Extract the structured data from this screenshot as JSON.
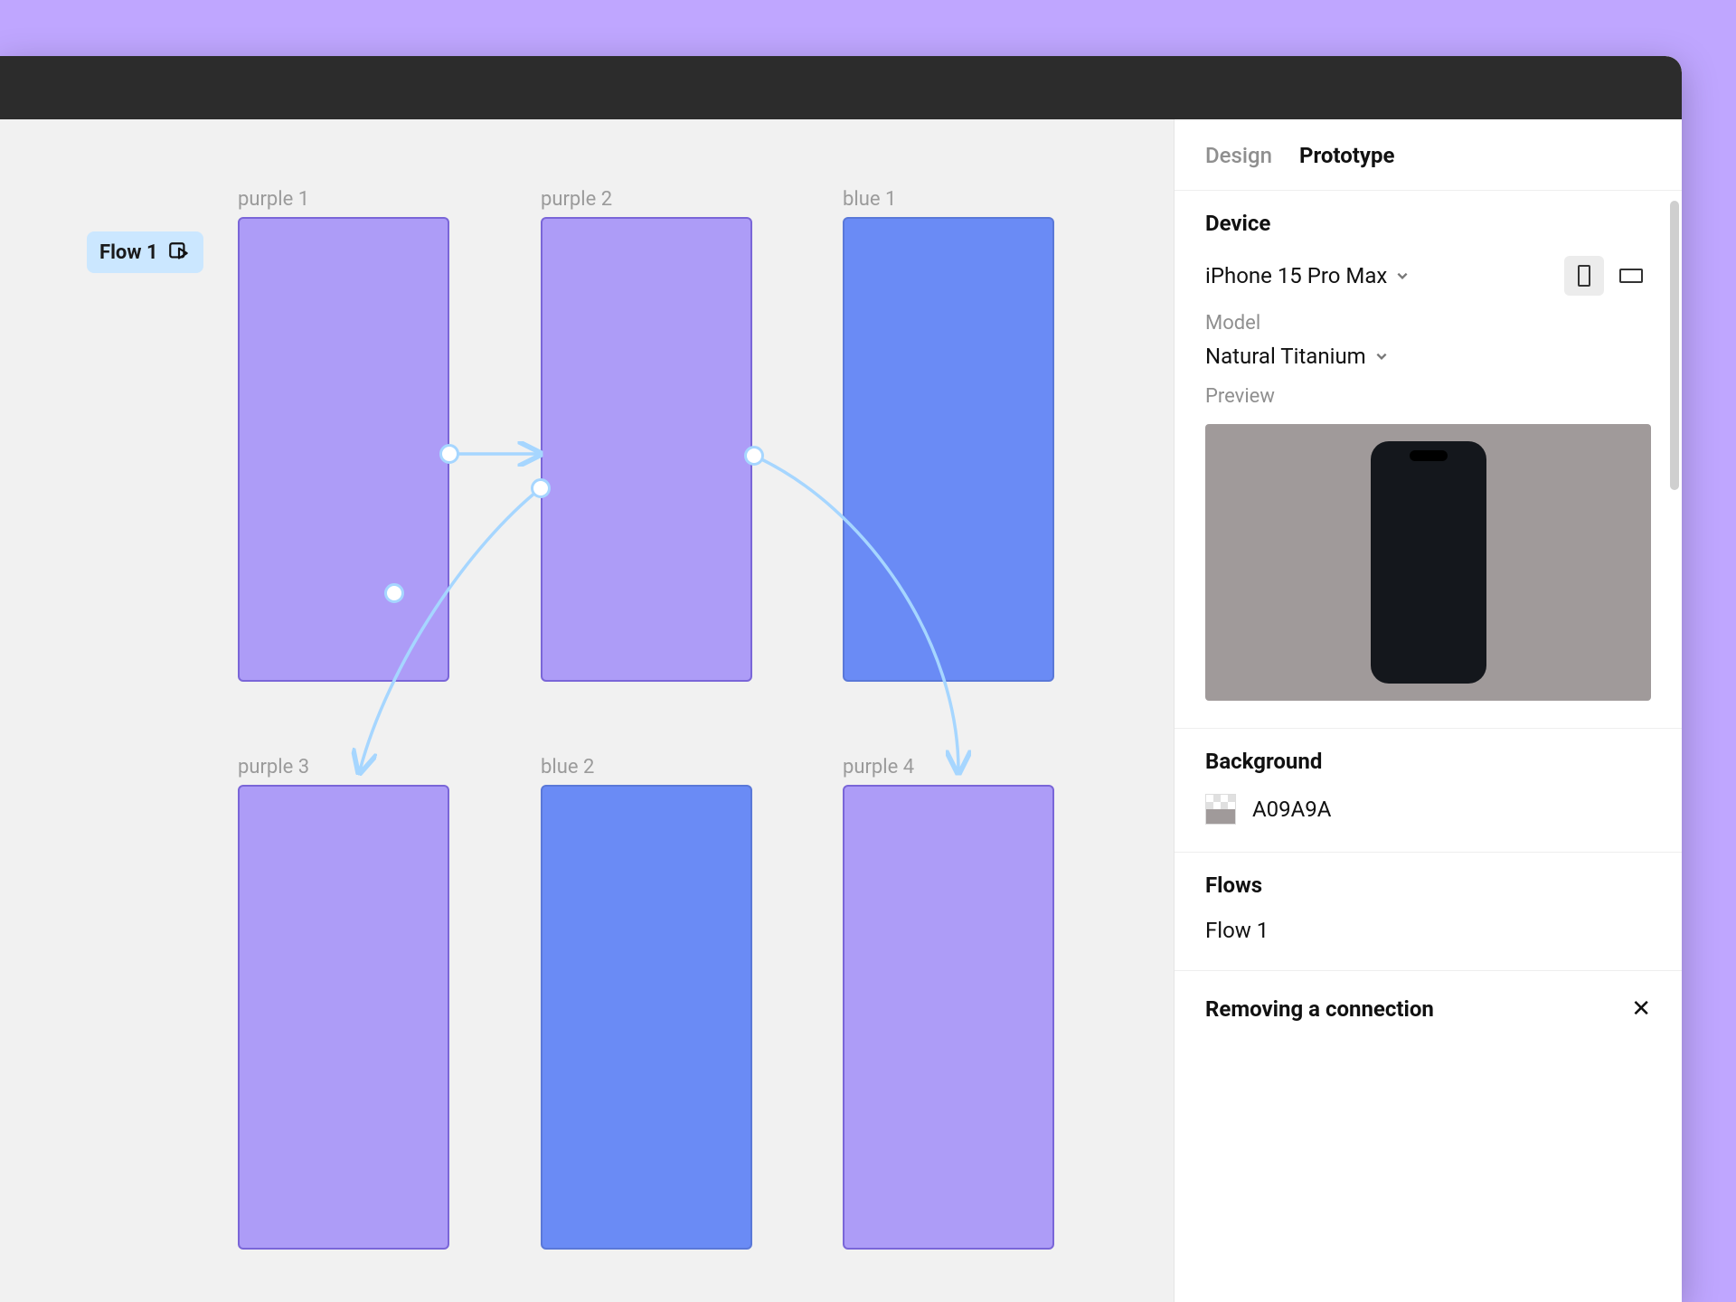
{
  "canvas": {
    "flow_badge": "Flow 1",
    "frames": [
      {
        "id": "purple-1",
        "label": "purple 1",
        "color": "purple"
      },
      {
        "id": "purple-2",
        "label": "purple 2",
        "color": "purple"
      },
      {
        "id": "blue-1",
        "label": "blue 1",
        "color": "blue"
      },
      {
        "id": "purple-3",
        "label": "purple 3",
        "color": "purple"
      },
      {
        "id": "blue-2",
        "label": "blue 2",
        "color": "blue"
      },
      {
        "id": "purple-4",
        "label": "purple 4",
        "color": "purple"
      }
    ]
  },
  "sidebar": {
    "tabs": {
      "design": "Design",
      "prototype": "Prototype",
      "active": "prototype"
    },
    "device": {
      "title": "Device",
      "selected": "iPhone 15 Pro Max",
      "model_label": "Model",
      "model_selected": "Natural Titanium",
      "preview_label": "Preview",
      "orientation": "portrait"
    },
    "background": {
      "title": "Background",
      "value": "A09A9A",
      "hex": "#A09A9A"
    },
    "flows": {
      "title": "Flows",
      "items": [
        "Flow 1"
      ]
    },
    "tip": {
      "title": "Removing a connection"
    }
  }
}
